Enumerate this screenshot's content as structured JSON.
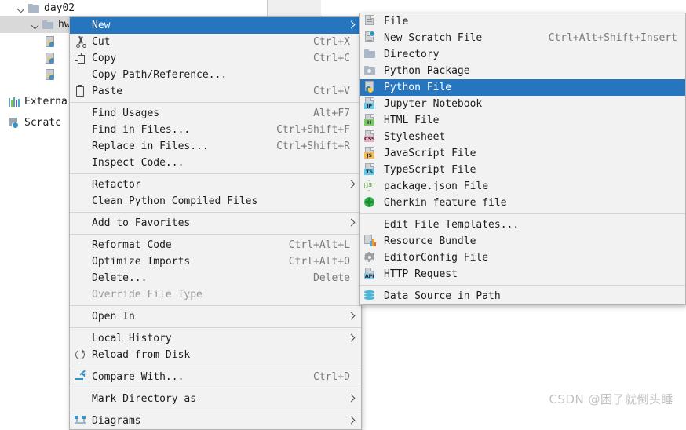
{
  "colors": {
    "accent": "#2675bf",
    "menu_bg": "#f2f2f2",
    "menu_border": "#b4b4b4",
    "tree_selected": "#d9d9d9",
    "accel_text": "#7a7a7a",
    "disabled_text": "#9b9b9b",
    "watermark": "#c3c3c3"
  },
  "project_tree": {
    "items": [
      {
        "label": "day02",
        "icon": "folder-icon",
        "chevron": "chevron-down-icon",
        "indent": 20,
        "selected": false
      },
      {
        "label": "hw",
        "icon": "folder-icon",
        "chevron": "chevron-down-icon",
        "indent": 38,
        "selected": true
      },
      {
        "label": "",
        "icon": "python-file-icon",
        "chevron": "",
        "indent": 56,
        "selected": false
      },
      {
        "label": "",
        "icon": "python-file-icon",
        "chevron": "",
        "indent": 56,
        "selected": false
      },
      {
        "label": "",
        "icon": "python-file-icon",
        "chevron": "",
        "indent": 56,
        "selected": false
      },
      {
        "label": "External",
        "icon": "external-libraries-icon",
        "chevron": "",
        "indent": 10,
        "selected": false
      },
      {
        "label": "Scratc",
        "icon": "scratches-icon",
        "chevron": "",
        "indent": 10,
        "selected": false
      }
    ]
  },
  "context_menu": {
    "name": "project-context-menu",
    "items": [
      {
        "type": "item",
        "label": "New",
        "accel": "",
        "icon": "",
        "submenu": true,
        "highlighted": true,
        "mnemonic": "N"
      },
      {
        "type": "item",
        "label": "Cut",
        "accel": "Ctrl+X",
        "icon": "scissors-icon",
        "submenu": false,
        "mnemonic": "t"
      },
      {
        "type": "item",
        "label": "Copy",
        "accel": "Ctrl+C",
        "icon": "copy-icon",
        "submenu": false,
        "mnemonic": "C"
      },
      {
        "type": "item",
        "label": "Copy Path/Reference...",
        "accel": "",
        "icon": "",
        "submenu": false
      },
      {
        "type": "item",
        "label": "Paste",
        "accel": "Ctrl+V",
        "icon": "paste-icon",
        "submenu": false,
        "mnemonic": "P"
      },
      {
        "type": "separator"
      },
      {
        "type": "item",
        "label": "Find Usages",
        "accel": "Alt+F7",
        "icon": "",
        "submenu": false,
        "mnemonic": "U"
      },
      {
        "type": "item",
        "label": "Find in Files...",
        "accel": "Ctrl+Shift+F",
        "icon": "",
        "submenu": false
      },
      {
        "type": "item",
        "label": "Replace in Files...",
        "accel": "Ctrl+Shift+R",
        "icon": "",
        "submenu": false,
        "mnemonic": "a"
      },
      {
        "type": "item",
        "label": "Inspect Code...",
        "accel": "",
        "icon": "",
        "submenu": false,
        "mnemonic": "I"
      },
      {
        "type": "separator"
      },
      {
        "type": "item",
        "label": "Refactor",
        "accel": "",
        "icon": "",
        "submenu": true,
        "mnemonic": "R"
      },
      {
        "type": "item",
        "label": "Clean Python Compiled Files",
        "accel": "",
        "icon": "",
        "submenu": false
      },
      {
        "type": "separator"
      },
      {
        "type": "item",
        "label": "Add to Favorites",
        "accel": "",
        "icon": "",
        "submenu": true,
        "mnemonic": "v"
      },
      {
        "type": "separator"
      },
      {
        "type": "item",
        "label": "Reformat Code",
        "accel": "Ctrl+Alt+L",
        "icon": "",
        "submenu": false,
        "mnemonic": "R"
      },
      {
        "type": "item",
        "label": "Optimize Imports",
        "accel": "Ctrl+Alt+O",
        "icon": "",
        "submenu": false,
        "mnemonic": "z"
      },
      {
        "type": "item",
        "label": "Delete...",
        "accel": "Delete",
        "icon": "",
        "submenu": false,
        "mnemonic": "D"
      },
      {
        "type": "item",
        "label": "Override File Type",
        "accel": "",
        "icon": "",
        "submenu": false,
        "disabled": true
      },
      {
        "type": "separator"
      },
      {
        "type": "item",
        "label": "Open In",
        "accel": "",
        "icon": "",
        "submenu": true
      },
      {
        "type": "separator"
      },
      {
        "type": "item",
        "label": "Local History",
        "accel": "",
        "icon": "",
        "submenu": true,
        "mnemonic": "H"
      },
      {
        "type": "item",
        "label": "Reload from Disk",
        "accel": "",
        "icon": "reload-icon",
        "submenu": false
      },
      {
        "type": "separator"
      },
      {
        "type": "item",
        "label": "Compare With...",
        "accel": "Ctrl+D",
        "icon": "compare-icon",
        "submenu": false
      },
      {
        "type": "separator"
      },
      {
        "type": "item",
        "label": "Mark Directory as",
        "accel": "",
        "icon": "",
        "submenu": true
      },
      {
        "type": "separator"
      },
      {
        "type": "item",
        "label": "Diagrams",
        "accel": "",
        "icon": "diagrams-icon",
        "submenu": true
      }
    ]
  },
  "new_submenu": {
    "name": "new-submenu",
    "items": [
      {
        "type": "item",
        "label": "File",
        "accel": "",
        "icon": "file-icon",
        "highlighted": false
      },
      {
        "type": "item",
        "label": "New Scratch File",
        "accel": "Ctrl+Alt+Shift+Insert",
        "icon": "scratch-file-icon",
        "highlighted": false
      },
      {
        "type": "item",
        "label": "Directory",
        "accel": "",
        "icon": "directory-icon",
        "highlighted": false
      },
      {
        "type": "item",
        "label": "Python Package",
        "accel": "",
        "icon": "python-package-icon",
        "highlighted": false
      },
      {
        "type": "item",
        "label": "Python File",
        "accel": "",
        "icon": "python-file-icon",
        "highlighted": true
      },
      {
        "type": "item",
        "label": "Jupyter Notebook",
        "accel": "",
        "icon": "jupyter-notebook-icon",
        "highlighted": false
      },
      {
        "type": "item",
        "label": "HTML File",
        "accel": "",
        "icon": "html-file-icon",
        "highlighted": false
      },
      {
        "type": "item",
        "label": "Stylesheet",
        "accel": "",
        "icon": "stylesheet-icon",
        "highlighted": false
      },
      {
        "type": "item",
        "label": "JavaScript File",
        "accel": "",
        "icon": "javascript-file-icon",
        "highlighted": false
      },
      {
        "type": "item",
        "label": "TypeScript File",
        "accel": "",
        "icon": "typescript-file-icon",
        "highlighted": false
      },
      {
        "type": "item",
        "label": "package.json File",
        "accel": "",
        "icon": "node-package-icon",
        "highlighted": false
      },
      {
        "type": "item",
        "label": "Gherkin feature file",
        "accel": "",
        "icon": "gherkin-icon",
        "highlighted": false
      },
      {
        "type": "separator"
      },
      {
        "type": "item",
        "label": "Edit File Templates...",
        "accel": "",
        "icon": "",
        "highlighted": false
      },
      {
        "type": "item",
        "label": "Resource Bundle",
        "accel": "",
        "icon": "resource-bundle-icon",
        "highlighted": false
      },
      {
        "type": "item",
        "label": "EditorConfig File",
        "accel": "",
        "icon": "gear-icon",
        "highlighted": false
      },
      {
        "type": "item",
        "label": "HTTP Request",
        "accel": "",
        "icon": "http-request-icon",
        "highlighted": false
      },
      {
        "type": "separator"
      },
      {
        "type": "item",
        "label": "Data Source in Path",
        "accel": "",
        "icon": "database-icon",
        "highlighted": false
      }
    ]
  },
  "watermark": {
    "text": "CSDN @困了就倒头睡"
  }
}
